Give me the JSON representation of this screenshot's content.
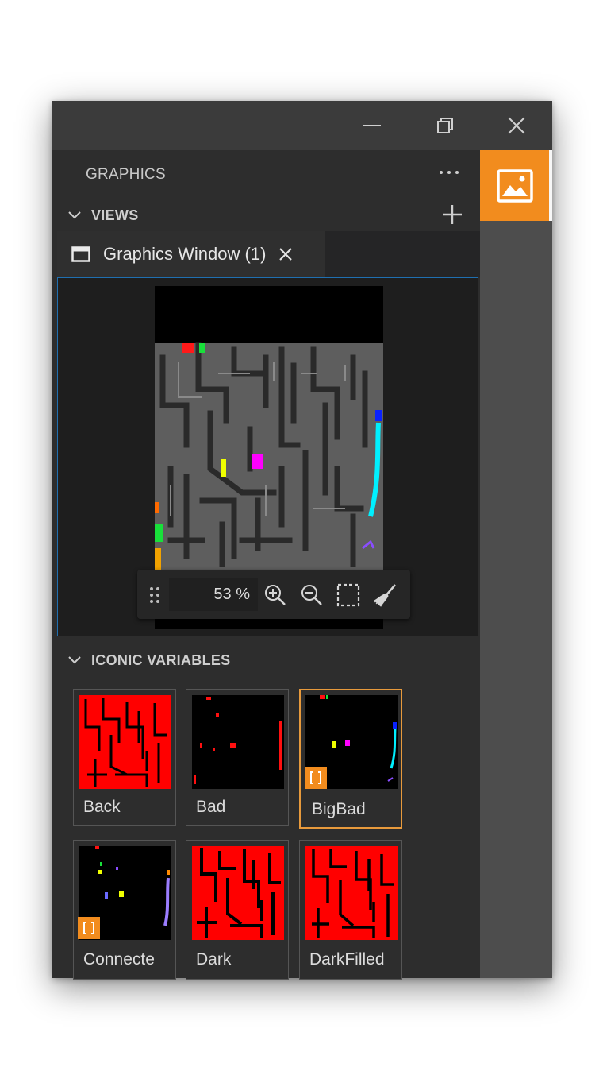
{
  "window": {
    "controls": {
      "minimize": "minimize-icon",
      "restore": "restore-icon",
      "close": "close-icon"
    }
  },
  "panel": {
    "title": "GRAPHICS",
    "more_icon": "ellipsis-icon",
    "views": {
      "label": "VIEWS",
      "add_icon": "plus-icon",
      "tab": {
        "label": "Graphics Window (1)",
        "icon": "window-icon",
        "close_icon": "close-icon"
      }
    },
    "graphics_window": {
      "zoom": "53 %",
      "tools": [
        "drag-handle-icon",
        "zoom-in-icon",
        "zoom-out-icon",
        "fit-selection-icon",
        "clear-broom-icon"
      ]
    },
    "iconic_variables": {
      "label": "ICONIC VARIABLES",
      "items": [
        {
          "name": "Back",
          "selected": false,
          "badge": false
        },
        {
          "name": "Bad",
          "selected": false,
          "badge": false
        },
        {
          "name": "BigBad",
          "selected": true,
          "badge": true
        },
        {
          "name": "Connecte",
          "selected": false,
          "badge": true
        },
        {
          "name": "Dark",
          "selected": false,
          "badge": false
        },
        {
          "name": "DarkFilled",
          "selected": false,
          "badge": false
        }
      ]
    }
  },
  "activity_bar": {
    "graphics_icon": "image-icon"
  },
  "colors": {
    "accent": "#f28c1e",
    "selection_border": "#e89a3c",
    "focus_border": "#1f6fb0",
    "region_red": "#ff0000"
  }
}
